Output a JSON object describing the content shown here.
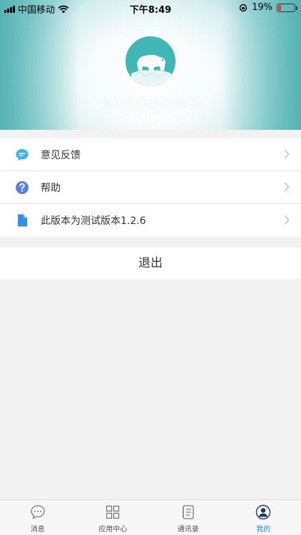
{
  "status_bar": {
    "carrier": "中国移动",
    "time": "下午8:49",
    "battery_percent": "19%"
  },
  "profile": {
    "name": "森松集团管理员-朱",
    "role": "集团管理员"
  },
  "menu": {
    "items": [
      {
        "label": "意见反馈",
        "icon": "feedback-icon"
      },
      {
        "label": "帮助",
        "icon": "help-icon"
      },
      {
        "label": "此版本为测试版本1.2.6",
        "icon": "document-icon"
      }
    ]
  },
  "logout_label": "退出",
  "tabbar": {
    "tabs": [
      {
        "label": "消息",
        "icon": "message-icon"
      },
      {
        "label": "应用中心",
        "icon": "apps-grid-icon"
      },
      {
        "label": "通讯录",
        "icon": "contacts-icon"
      },
      {
        "label": "我的",
        "icon": "profile-icon"
      }
    ],
    "active_index": 3
  },
  "colors": {
    "accent": "#1a8ff5",
    "teal": "#3fb8b5",
    "battery_low": "#e33"
  }
}
